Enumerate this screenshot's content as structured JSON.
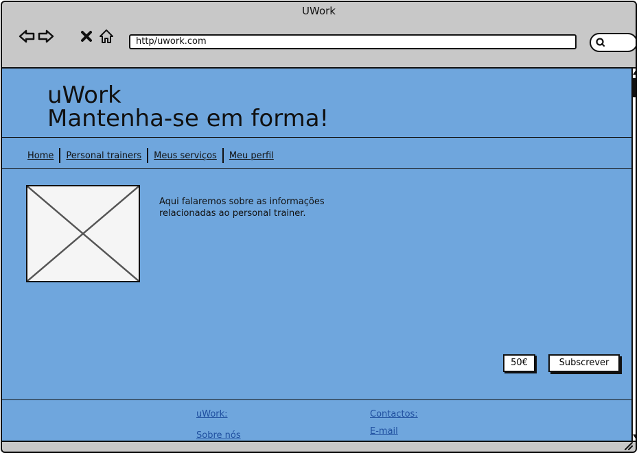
{
  "browser": {
    "title": "UWork",
    "url": "http/uwork.com",
    "icons": [
      "back-arrow-icon",
      "forward-arrow-icon",
      "close-x-icon",
      "home-icon",
      "search-icon"
    ]
  },
  "header": {
    "line1": "uWork",
    "line2": "Mantenha-se em forma!"
  },
  "menu": {
    "items": [
      "Home",
      "Personal trainers",
      "Meus serviços",
      "Meu perfil"
    ]
  },
  "content": {
    "description": "Aqui falaremos sobre as informações relacionadas ao personal trainer.",
    "price": "50€",
    "subscribe_label": "Subscrever"
  },
  "footer": {
    "col1": [
      "uWork:",
      "Sobre nós"
    ],
    "col2": [
      "Contactos:",
      "E-mail"
    ]
  },
  "colors": {
    "page_bg": "#6fa6dd",
    "chrome_bg": "#c8c8c8",
    "link": "#1f4f9f"
  }
}
